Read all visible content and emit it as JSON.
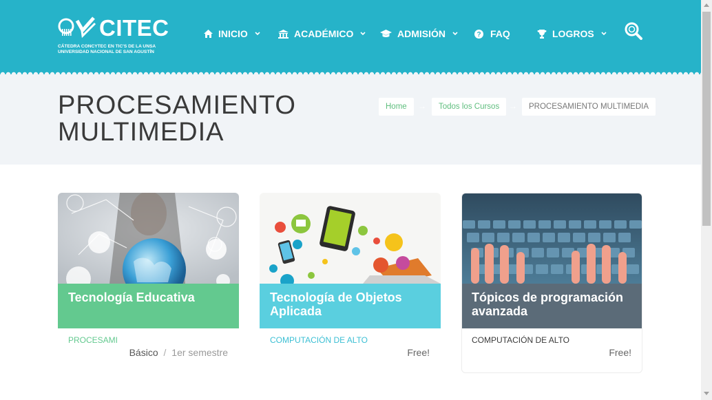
{
  "brand": {
    "name": "CITEC",
    "subtitle_line1": "CÁTEDRA CONCYTEC EN TIC'S DE LA UNSA",
    "subtitle_line2": "UNIVERSIDAD NACIONAL DE SAN AGUSTÍN",
    "accent_color": "#26b3c9"
  },
  "nav": {
    "items": [
      {
        "label": "INICIO",
        "icon": "home-icon",
        "dropdown": true
      },
      {
        "label": "ACADÉMICO",
        "icon": "bank-icon",
        "dropdown": true
      },
      {
        "label": "ADMISIÓN",
        "icon": "graduation-cap-icon",
        "dropdown": true
      },
      {
        "label": "FAQ",
        "icon": "question-circle-icon",
        "dropdown": false
      },
      {
        "label": "LOGROS",
        "icon": "trophy-icon",
        "dropdown": true
      }
    ],
    "search_icon": "search-icon"
  },
  "page": {
    "title": "PROCESAMIENTO MULTIMEDIA"
  },
  "breadcrumb": {
    "items": [
      "Home",
      "Todos los Cursos"
    ],
    "current": "PROCESAMIENTO MULTIMEDIA",
    "separator": "→"
  },
  "cards": [
    {
      "title": "Tecnología Educativa",
      "category": "PROCESAMI",
      "meta_level": "Básico",
      "meta_sep": "/",
      "meta_term": "1er semestre",
      "band_color": "#63c98f",
      "category_color": "#63c98f"
    },
    {
      "title": "Tecnología de Objetos Aplicada",
      "category": "COMPUTACIÓN DE ALTO",
      "price": "Free!",
      "band_color": "#5acfdf",
      "category_color": "#3bbfd4"
    },
    {
      "title": "Tópicos de programación avanzada",
      "category": "COMPUTACIÓN DE ALTO",
      "price": "Free!",
      "band_color": "#5b6b78",
      "category_color": "#3a3a3a"
    }
  ]
}
